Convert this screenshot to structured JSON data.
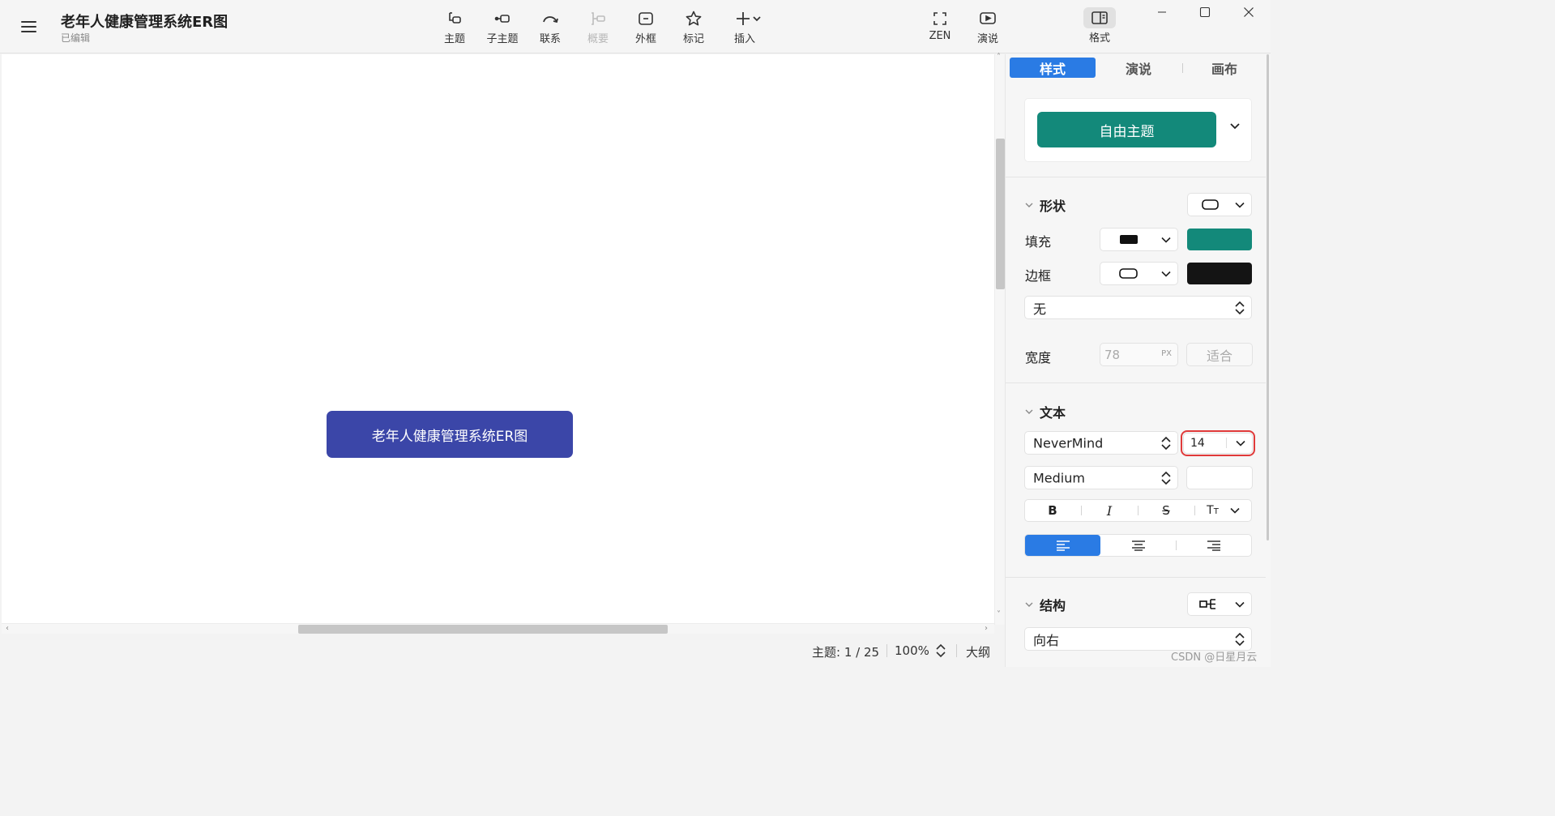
{
  "app": {
    "title": "老年人健康管理系统ER图",
    "status": "已编辑"
  },
  "toolbar": {
    "topic": "主题",
    "subtopic": "子主题",
    "relationship": "联系",
    "summary": "概要",
    "boundary": "外框",
    "marker": "标记",
    "insert": "插入",
    "zen": "ZEN",
    "pitch": "演说",
    "format": "格式"
  },
  "canvas": {
    "central_topic": "老年人健康管理系统ER图"
  },
  "statusbar": {
    "topic_count": "主题: 1 / 25",
    "zoom": "100%",
    "outline": "大纲"
  },
  "panel": {
    "tabs": [
      "样式",
      "演说",
      "画布"
    ],
    "theme_button": "自由主题",
    "shape": {
      "title": "形状",
      "fill_label": "填充",
      "border_label": "边框",
      "border_style": "无",
      "width_label": "宽度",
      "width_value": "78",
      "width_unit": "PX",
      "fit_button": "适合",
      "fill_color": "#13897a",
      "border_color": "#141414"
    },
    "text": {
      "title": "文本",
      "font": "NeverMind",
      "size": "14",
      "weight": "Medium"
    },
    "structure": {
      "title": "结构",
      "direction": "向右"
    }
  },
  "watermark": "CSDN @日星月云",
  "colors": {
    "accent": "#2a7be4",
    "central_topic": "#3b46a8",
    "theme": "#13897a"
  }
}
